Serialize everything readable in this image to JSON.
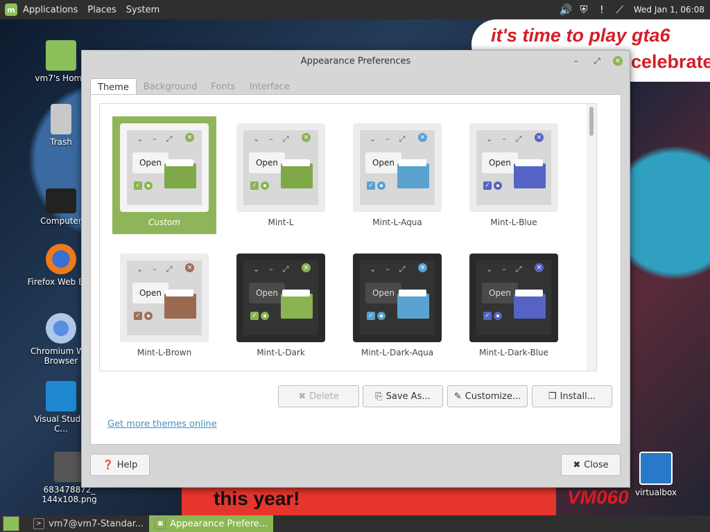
{
  "topbar": {
    "menus": [
      "Applications",
      "Places",
      "System"
    ],
    "clock": "Wed Jan  1, 06:08",
    "tray_icons": [
      "volume-icon",
      "shield-icon",
      "notification-icon",
      "network-icon"
    ]
  },
  "desktop": {
    "icons": [
      {
        "name": "home-folder",
        "label": "vm7's Home"
      },
      {
        "name": "trash",
        "label": "Trash"
      },
      {
        "name": "computer",
        "label": "Computer"
      },
      {
        "name": "firefox",
        "label": "Firefox Web Br..."
      },
      {
        "name": "chromium",
        "label": "Chromium W... Browser"
      },
      {
        "name": "vscode",
        "label": "Visual Studio C..."
      },
      {
        "name": "image-file",
        "label": "683478872_ 144x108.png"
      },
      {
        "name": "virtualbox",
        "label": "virtualbox"
      }
    ],
    "wallpaper_text": {
      "speech1": "it's time to play gta6",
      "speech2": "celebrate",
      "banner": "this year!",
      "vm": "VM060"
    }
  },
  "window": {
    "title": "Appearance Preferences",
    "tabs": [
      {
        "label": "Theme",
        "active": true
      },
      {
        "label": "Background",
        "active": false
      },
      {
        "label": "Fonts",
        "active": false
      },
      {
        "label": "Interface",
        "active": false
      }
    ],
    "themes": [
      {
        "name": "Custom",
        "selected": true,
        "dark": false,
        "accent": "#8ab452",
        "folder": "#7fa848"
      },
      {
        "name": "Mint-L",
        "selected": false,
        "dark": false,
        "accent": "#8ab452",
        "folder": "#7fa848"
      },
      {
        "name": "Mint-L-Aqua",
        "selected": false,
        "dark": false,
        "accent": "#5aa2cf",
        "folder": "#5aa2cf"
      },
      {
        "name": "Mint-L-Blue",
        "selected": false,
        "dark": false,
        "accent": "#5564c4",
        "folder": "#5564c4"
      },
      {
        "name": "Mint-L-Brown",
        "selected": false,
        "dark": false,
        "accent": "#a0705a",
        "folder": "#9a6a50"
      },
      {
        "name": "Mint-L-Dark",
        "selected": false,
        "dark": true,
        "accent": "#8ab452",
        "folder": "#8ab452"
      },
      {
        "name": "Mint-L-Dark-Aqua",
        "selected": false,
        "dark": true,
        "accent": "#5aa2cf",
        "folder": "#5aa2cf"
      },
      {
        "name": "Mint-L-Dark-Blue",
        "selected": false,
        "dark": true,
        "accent": "#5564c4",
        "folder": "#5564c4"
      }
    ],
    "thumb_open_label": "Open",
    "buttons": {
      "delete": "Delete",
      "save_as": "Save As...",
      "customize": "Customize...",
      "install": "Install..."
    },
    "link": "Get more themes online",
    "help": "Help",
    "close": "Close"
  },
  "taskbar": {
    "items": [
      {
        "label": "vm7@vm7-Standar...",
        "active": false
      },
      {
        "label": "Appearance Prefere...",
        "active": true
      }
    ]
  }
}
